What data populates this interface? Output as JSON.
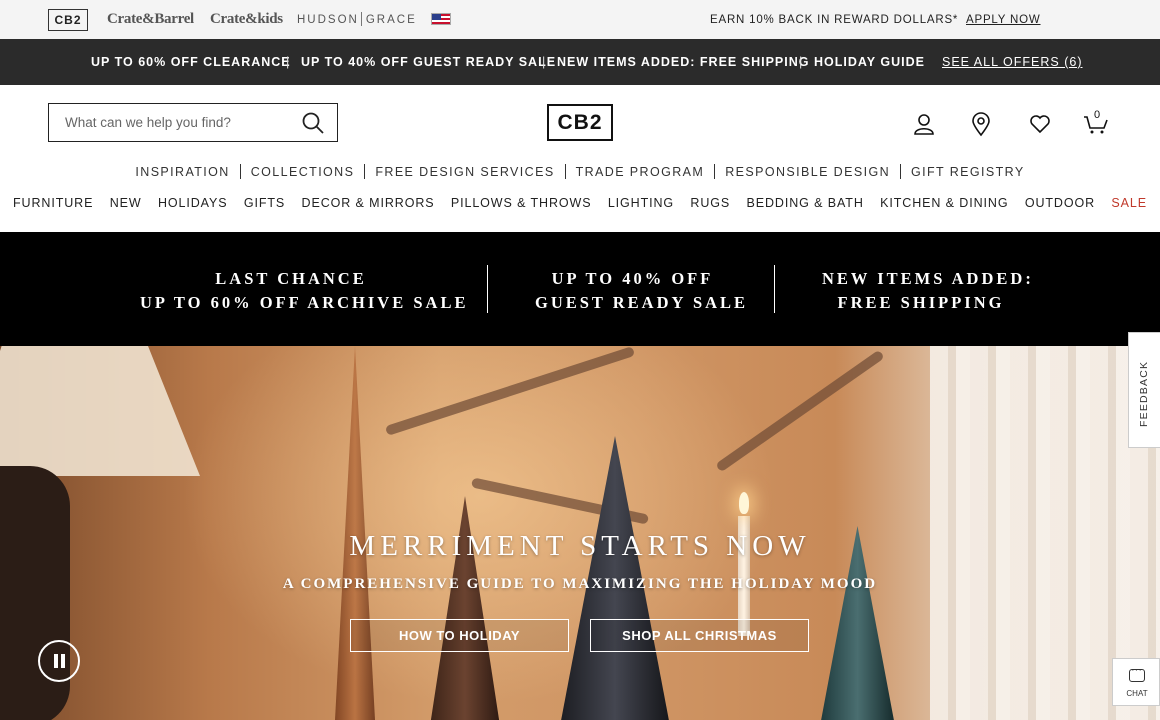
{
  "brand_bar": {
    "cb2": "CB2",
    "crate_barrel": "Crate&Barrel",
    "crate_kids": "Crate&kids",
    "hudson": "HUDSON",
    "grace": "GRACE",
    "flag_icon": "us-flag-icon",
    "reward_text": "EARN 10% BACK IN REWARD DOLLARS*",
    "apply_now": "APPLY NOW"
  },
  "promo_strip": {
    "items": [
      "UP TO 60% OFF CLEARANCE",
      "UP TO 40% OFF GUEST READY SALE",
      "NEW ITEMS ADDED: FREE SHIPPING",
      "HOLIDAY GUIDE"
    ],
    "divider": "|",
    "see_all": "SEE ALL OFFERS (6)"
  },
  "header": {
    "search_placeholder": "What can we help you find?",
    "logo": "CB2",
    "cart_count": "0",
    "icons": [
      "account-icon",
      "store-locator-icon",
      "favorites-icon",
      "cart-icon"
    ]
  },
  "nav_secondary": [
    "INSPIRATION",
    "COLLECTIONS",
    "FREE DESIGN SERVICES",
    "TRADE PROGRAM",
    "RESPONSIBLE DESIGN",
    "GIFT REGISTRY"
  ],
  "nav_primary": [
    "FURNITURE",
    "NEW",
    "HOLIDAYS",
    "GIFTS",
    "DECOR & MIRRORS",
    "PILLOWS & THROWS",
    "LIGHTING",
    "RUGS",
    "BEDDING & BATH",
    "KITCHEN & DINING",
    "OUTDOOR",
    "SALE"
  ],
  "sale_color": "#c0392b",
  "black_banner": {
    "col1": [
      "LAST CHANCE",
      "UP TO 60% OFF ARCHIVE SALE"
    ],
    "col2": [
      "UP TO 40% OFF",
      "GUEST READY SALE"
    ],
    "col3": [
      "NEW ITEMS ADDED:",
      "FREE SHIPPING"
    ]
  },
  "hero": {
    "headline": "MERRIMENT STARTS NOW",
    "subline": "A COMPREHENSIVE GUIDE TO MAXIMIZING THE HOLIDAY MOOD",
    "button1": "HOW TO HOLIDAY",
    "button2": "SHOP ALL CHRISTMAS"
  },
  "widgets": {
    "feedback": "FEEDBACK",
    "chat": "CHAT"
  }
}
